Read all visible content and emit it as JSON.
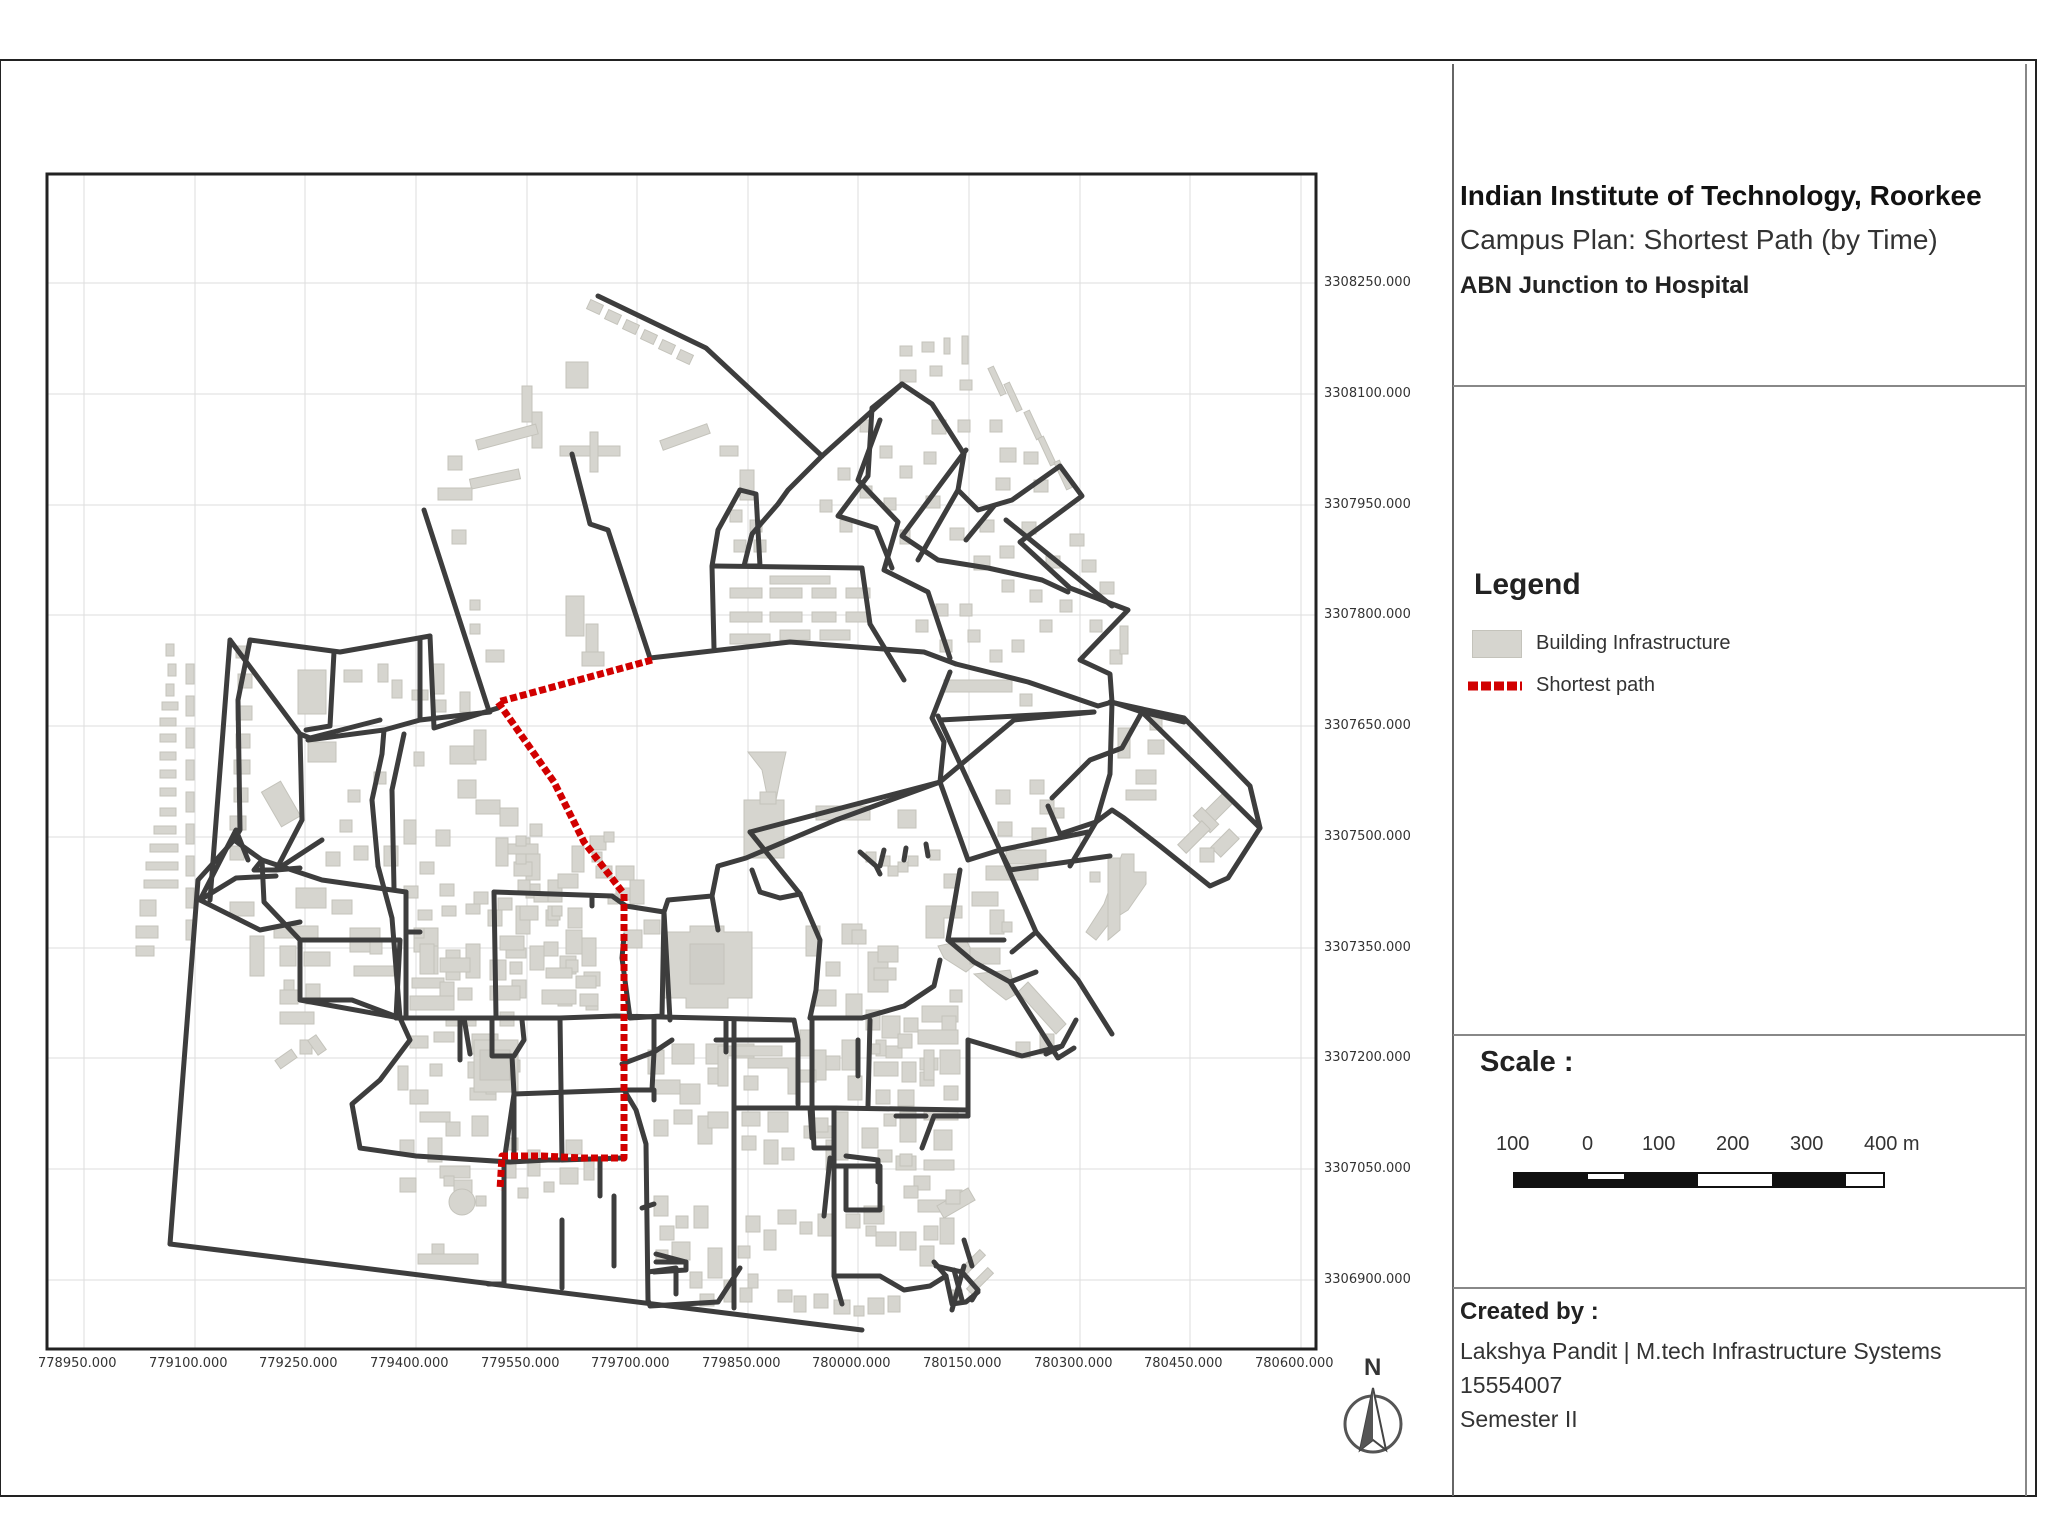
{
  "title": {
    "institute": "Indian Institute of Technology, Roorkee",
    "subtitle": "Campus Plan: Shortest Path (by Time)",
    "route": "ABN Junction to Hospital"
  },
  "legend": {
    "heading": "Legend",
    "items": [
      {
        "label": "Building Infrastructure",
        "symbol": "building-swatch",
        "color": "#d6d5cf"
      },
      {
        "label": "Shortest path",
        "symbol": "red-dashed-line",
        "color": "#d10000"
      }
    ]
  },
  "scale": {
    "heading": "Scale :",
    "labels": [
      "100",
      "0",
      "100",
      "200",
      "300",
      "400 m"
    ]
  },
  "credits": {
    "heading": "Created by :",
    "line1": "Lakshya Pandit | M.tech Infrastructure Systems",
    "line2": "15554007",
    "line3": "Semester II"
  },
  "north_arrow": {
    "label": "N",
    "icon": "north-arrow-icon"
  },
  "grid": {
    "y_labels": [
      "3308250.000",
      "3308100.000",
      "3307950.000",
      "3307800.000",
      "3307650.000",
      "3307500.000",
      "3307350.000",
      "3307200.000",
      "3307050.000",
      "3306900.000"
    ],
    "x_labels": [
      "778950.000",
      "779100.000",
      "779250.000",
      "779400.000",
      "779550.000",
      "779700.000",
      "779850.000",
      "780000.000",
      "780150.000",
      "780300.000",
      "780450.000",
      "780600.000"
    ]
  },
  "colors": {
    "road": "#3d3d3d",
    "building": "#d6d5cf",
    "building_stroke": "#c4c3bb",
    "route": "#d10000",
    "grid": "#dddddd",
    "frame": "#222222"
  }
}
